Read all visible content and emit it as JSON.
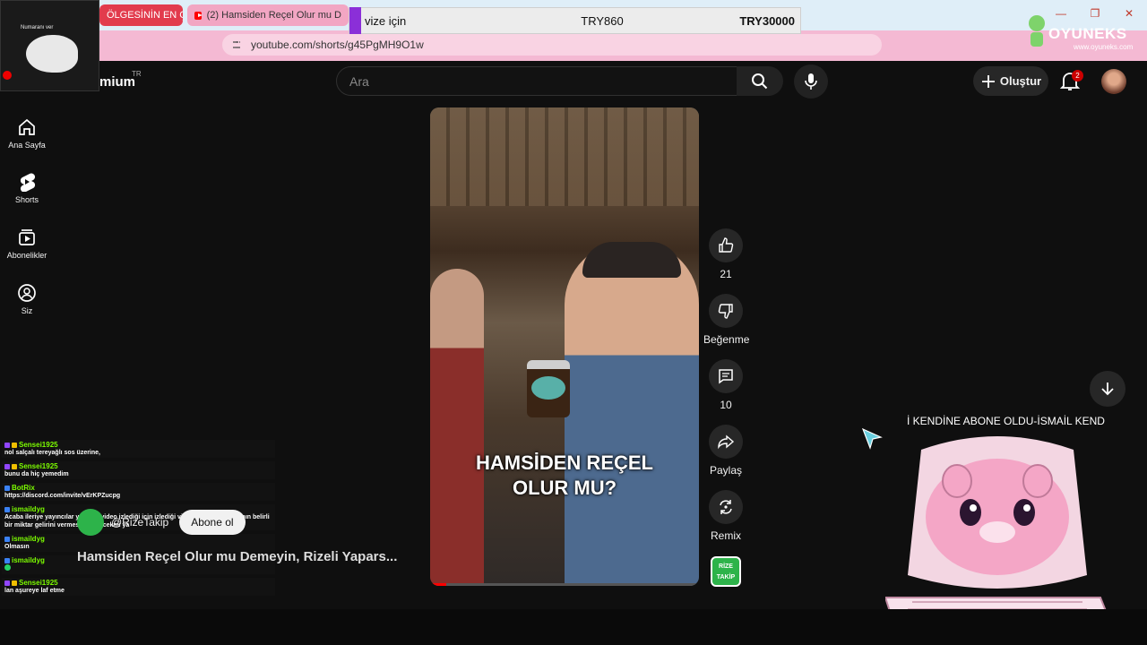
{
  "browser": {
    "tabs": [
      {
        "label": "ÖLGESİNİN EN ÇOK"
      },
      {
        "label": "(2) Hamsiden Reçel Olur mu D"
      }
    ],
    "url": "youtube.com/shorts/g45PgMH9O1w",
    "price_overlay": {
      "label": "vize için",
      "price1": "TRY860",
      "price2": "TRY30000"
    }
  },
  "webcam": {
    "label": "Numaranı ver"
  },
  "header": {
    "logo_text": "mium",
    "region": "TR",
    "search_placeholder": "Ara",
    "create_label": "Oluştur",
    "notification_count": "2"
  },
  "sidebar": {
    "items": [
      {
        "label": "Ana Sayfa",
        "icon": "home-icon"
      },
      {
        "label": "Shorts",
        "icon": "shorts-icon"
      },
      {
        "label": "Abonelikler",
        "icon": "subscriptions-icon"
      },
      {
        "label": "Siz",
        "icon": "user-icon"
      }
    ]
  },
  "video": {
    "caption_line1": "HAMSİDEN REÇEL",
    "caption_line2": "OLUR MU?",
    "progress": 0.06
  },
  "actions": {
    "like_count": "21",
    "dislike_label": "Beğenme",
    "comment_count": "10",
    "share_label": "Paylaş",
    "remix_label": "Remix",
    "channel_thumb_text": "RİZE TAKİP"
  },
  "channel": {
    "name": "@RizeTakip",
    "subscribe_label": "Abone ol",
    "video_title": "Hamsiden Reçel Olur mu Demeyin, Rizeli Yapars..."
  },
  "overlays": {
    "brand_name": "OYUNEKS",
    "brand_url": "www.oyuneks.com",
    "ticker": "İ KENDİNE ABONE OLDU-İSMAİL KEND"
  },
  "chat": [
    {
      "user": "Sensei1925",
      "text": "nol salçalı tereyağlı sos üzerine,"
    },
    {
      "user": "Sensei1925",
      "text": "bunu da hiç yemedim"
    },
    {
      "user": "BotRix",
      "text": "https://discord.com/invite/vErKPZucpg"
    },
    {
      "user": "ismaildyg",
      "text": "Acaba ileriye yayıncılar yayında video izlediği için izlediği videodaki kanala yayının belirli bir miktar gelirini vermesi gerekecekmi ya"
    },
    {
      "user": "ismaildyg",
      "text": "Olmasın"
    },
    {
      "user": "ismaildyg",
      "text": ""
    },
    {
      "user": "Sensei1925",
      "text": "lan aşureye laf etme"
    }
  ],
  "colors": {
    "tab_active": "#e23b4d",
    "accent_red": "#ff0000",
    "chat_user": "#7cfc00",
    "chrome_pink": "#f4b9d3"
  }
}
